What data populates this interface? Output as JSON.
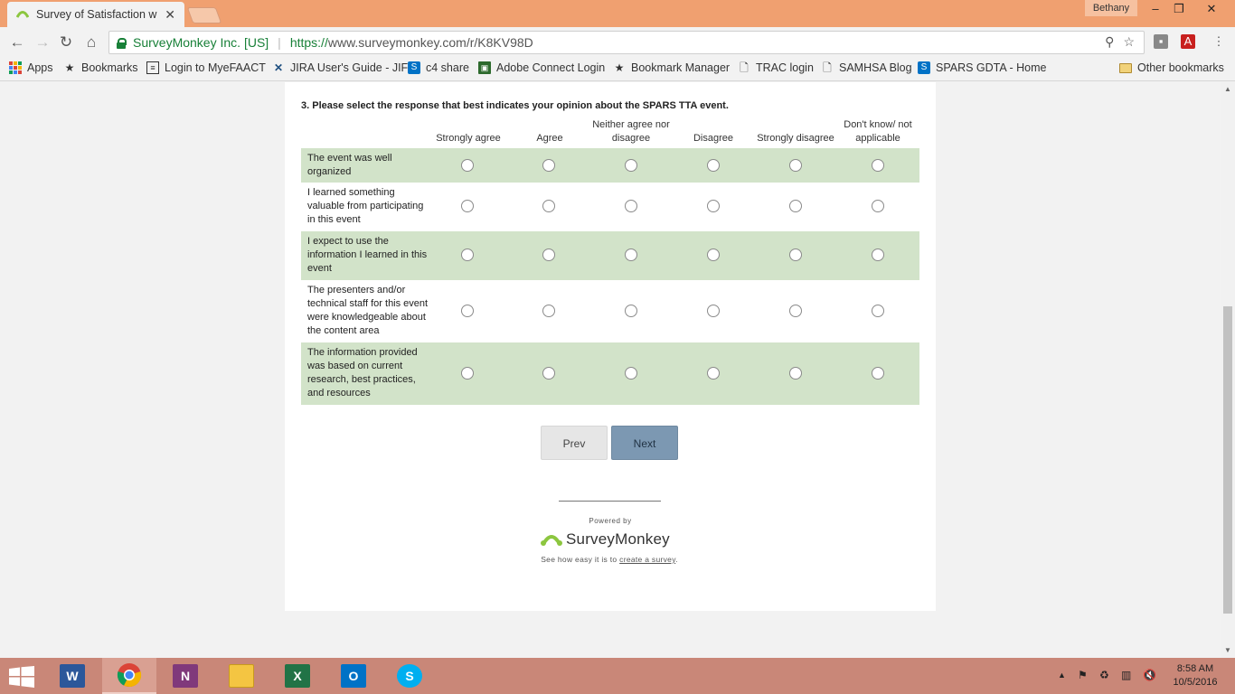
{
  "browser": {
    "tab_title": "Survey of Satisfaction wit",
    "profile_name": "Bethany",
    "controls": {
      "minimize": "–",
      "maximize": "❐",
      "close": "✕"
    },
    "address": {
      "secure_label": "SurveyMonkey Inc. [US]",
      "url_scheme": "https://",
      "url_rest": "www.surveymonkey.com/r/K8KV98D"
    },
    "bookmarks": [
      {
        "label": "Apps",
        "icon": "apps-grid-icon"
      },
      {
        "label": "Bookmarks",
        "icon": "star-icon"
      },
      {
        "label": "Login to MyeFAACT",
        "icon": "form-icon"
      },
      {
        "label": "JIRA User's Guide - JIF",
        "icon": "jira-icon"
      },
      {
        "label": "c4 share",
        "icon": "sharepoint-icon"
      },
      {
        "label": "Adobe Connect Login",
        "icon": "adobe-connect-icon"
      },
      {
        "label": "Bookmark Manager",
        "icon": "star-icon"
      },
      {
        "label": "TRAC login",
        "icon": "page-icon"
      },
      {
        "label": "SAMHSA Blog",
        "icon": "page-icon"
      },
      {
        "label": "SPARS GDTA - Home",
        "icon": "sharepoint-icon"
      }
    ],
    "other_bookmarks": "Other bookmarks"
  },
  "survey": {
    "question": "3. Please select the response that best indicates your opinion about the SPARS TTA event.",
    "columns": [
      "Strongly agree",
      "Agree",
      "Neither agree nor disagree",
      "Disagree",
      "Strongly disagree",
      "Don't know/ not applicable"
    ],
    "rows": [
      "The event was well organized",
      "I learned something valuable from participating in this event",
      "I expect to use the information I learned in this event",
      "The presenters and/or technical staff for this event were knowledgeable about the content area",
      "The information provided was based on current research, best practices, and resources"
    ],
    "prev_label": "Prev",
    "next_label": "Next"
  },
  "footer": {
    "powered_by": "Powered by",
    "brand": "SurveyMonkey",
    "see_how_prefix": "See how easy it is to",
    "see_how_link": "create a survey",
    "see_how_suffix": ".",
    "brand_color": "#8cc63f"
  },
  "taskbar": {
    "apps": [
      {
        "name": "word",
        "letter": "W",
        "color": "#2b579a"
      },
      {
        "name": "chrome",
        "letter": "",
        "color": "#ffffff"
      },
      {
        "name": "onenote",
        "letter": "N",
        "color": "#80397b"
      },
      {
        "name": "file-explorer",
        "letter": "",
        "color": "#f4c542"
      },
      {
        "name": "excel",
        "letter": "X",
        "color": "#217346"
      },
      {
        "name": "outlook",
        "letter": "O",
        "color": "#0072c6"
      },
      {
        "name": "skype",
        "letter": "S",
        "color": "#00aff0"
      }
    ],
    "time": "8:58 AM",
    "date": "10/5/2016"
  }
}
